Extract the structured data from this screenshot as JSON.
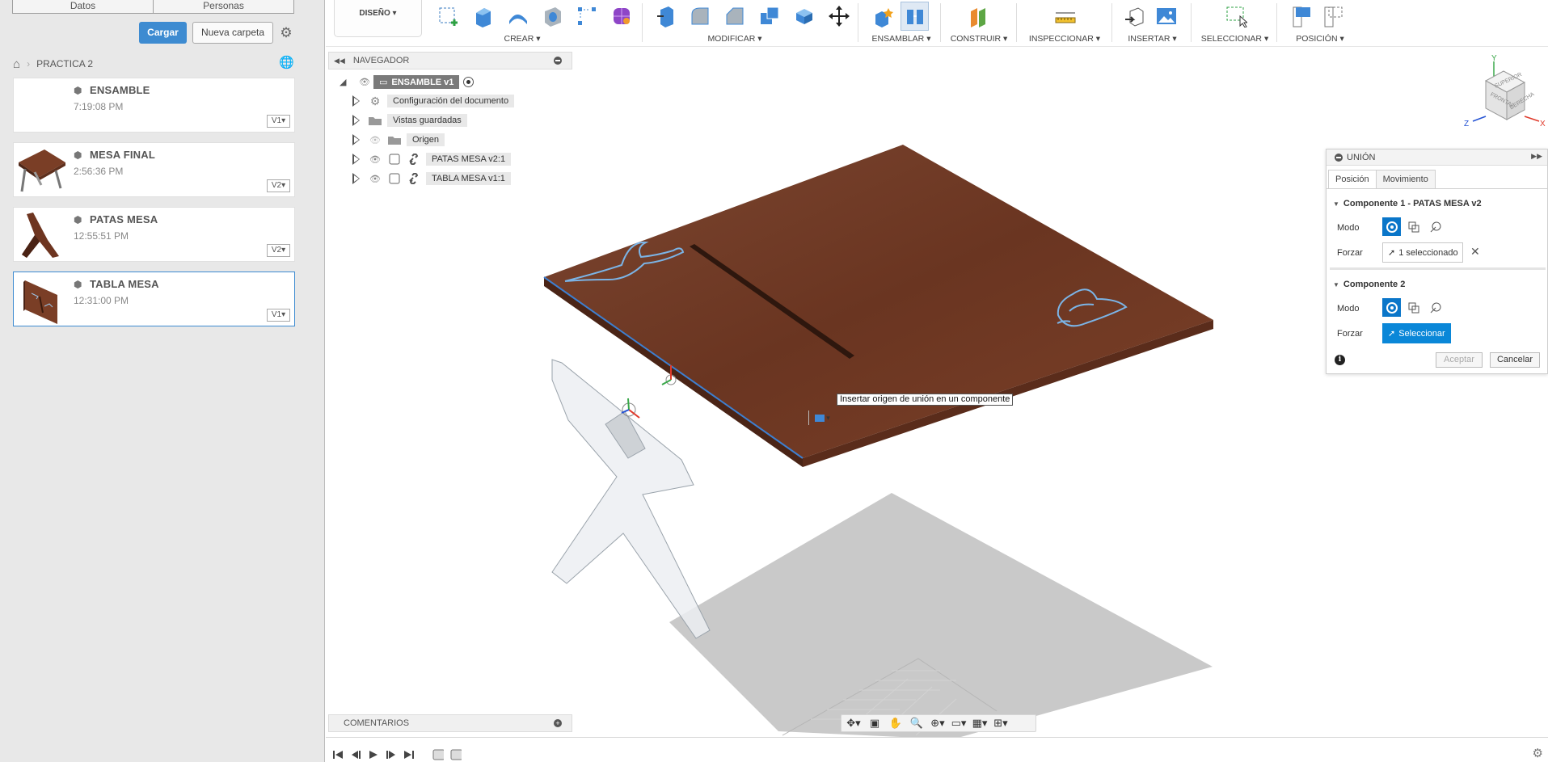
{
  "left_panel": {
    "tabs": [
      "Datos",
      "Personas"
    ],
    "upload_label": "Cargar",
    "new_folder_label": "Nueva carpeta",
    "breadcrumb_project": "PRACTICA 2",
    "files": [
      {
        "name": "ENSAMBLE",
        "time": "7:19:08 PM",
        "version": "V1"
      },
      {
        "name": "MESA FINAL",
        "time": "2:56:36 PM",
        "version": "V2"
      },
      {
        "name": "PATAS MESA",
        "time": "12:55:51 PM",
        "version": "V2"
      },
      {
        "name": "TABLA MESA",
        "time": "12:31:00 PM",
        "version": "V1"
      }
    ]
  },
  "toolbar": {
    "workspace": "DISEÑO",
    "groups": [
      "CREAR",
      "MODIFICAR",
      "ENSAMBLAR",
      "CONSTRUIR",
      "INSPECCIONAR",
      "INSERTAR",
      "SELECCIONAR",
      "POSICIÓN"
    ]
  },
  "navigator": {
    "title": "NAVEGADOR",
    "root": "ENSAMBLE v1",
    "items": [
      "Configuración del documento",
      "Vistas guardadas",
      "Origen",
      "PATAS MESA v2:1",
      "TABLA MESA v1:1"
    ]
  },
  "comments": {
    "title": "COMENTARIOS"
  },
  "viewcube": {
    "top": "SUPERIOR",
    "front": "FRONTAL",
    "right": "DERECHA",
    "x": "X",
    "y": "Y",
    "z": "Z"
  },
  "union": {
    "title": "UNIÓN",
    "tabs": [
      "Posición",
      "Movimiento"
    ],
    "component1": "Componente 1 - PATAS MESA v2",
    "component2": "Componente 2",
    "mode_label": "Modo",
    "snap_label": "Forzar",
    "snap1_value": "1 seleccionado",
    "snap2_value": "Seleccionar",
    "accept": "Aceptar",
    "cancel": "Cancelar"
  },
  "tooltip": "Insertar origen de unión en un componente",
  "colors": {
    "accent": "#0a87d8",
    "primary_button": "#3d8bd1",
    "wood": "#6b3a26",
    "outline_blue": "#5fa4dd"
  }
}
